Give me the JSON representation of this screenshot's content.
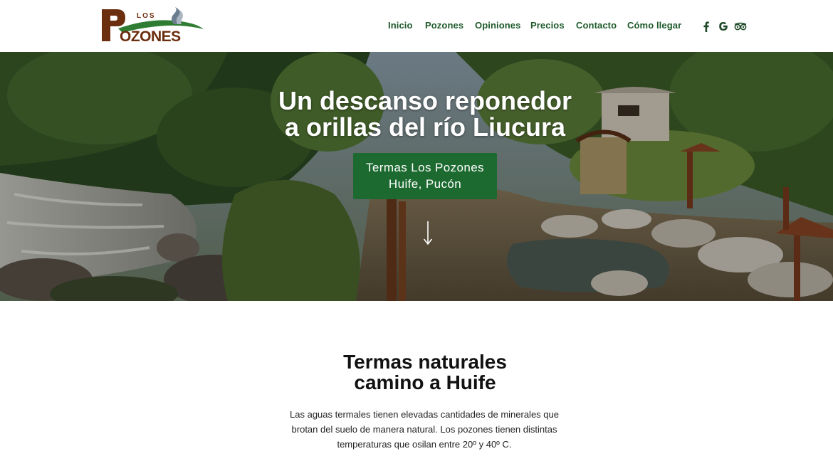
{
  "brand": {
    "logo_small": "LOS",
    "logo_main": "POZONES",
    "colors": {
      "brown": "#6b2e0f",
      "green": "#2f7d32",
      "nav_green": "#1f5a2b",
      "cta_green": "#1d6a30"
    }
  },
  "nav": {
    "items": [
      {
        "label": "Inicio"
      },
      {
        "label": "Pozones"
      },
      {
        "label": "Opiniones"
      },
      {
        "label": "Precios"
      },
      {
        "label": "Contacto"
      },
      {
        "label": "Cómo llegar"
      }
    ],
    "social": [
      {
        "icon": "facebook-icon"
      },
      {
        "icon": "google-icon"
      },
      {
        "icon": "tripadvisor-icon"
      }
    ]
  },
  "hero": {
    "title_line1": "Un descanso reponedor",
    "title_line2": "a orillas del río Liucura",
    "cta_line1": "Termas Los Pozones",
    "cta_line2": "Huife, Pucón",
    "scroll_icon": "arrow-down-icon"
  },
  "intro": {
    "title_line1": "Termas naturales",
    "title_line2": "camino a Huife",
    "paragraph": "Las aguas termales tienen elevadas cantidades de minerales que brotan del suelo de manera natural. Los pozones tienen distintas temperaturas que osilan entre 20º y 40º C."
  }
}
